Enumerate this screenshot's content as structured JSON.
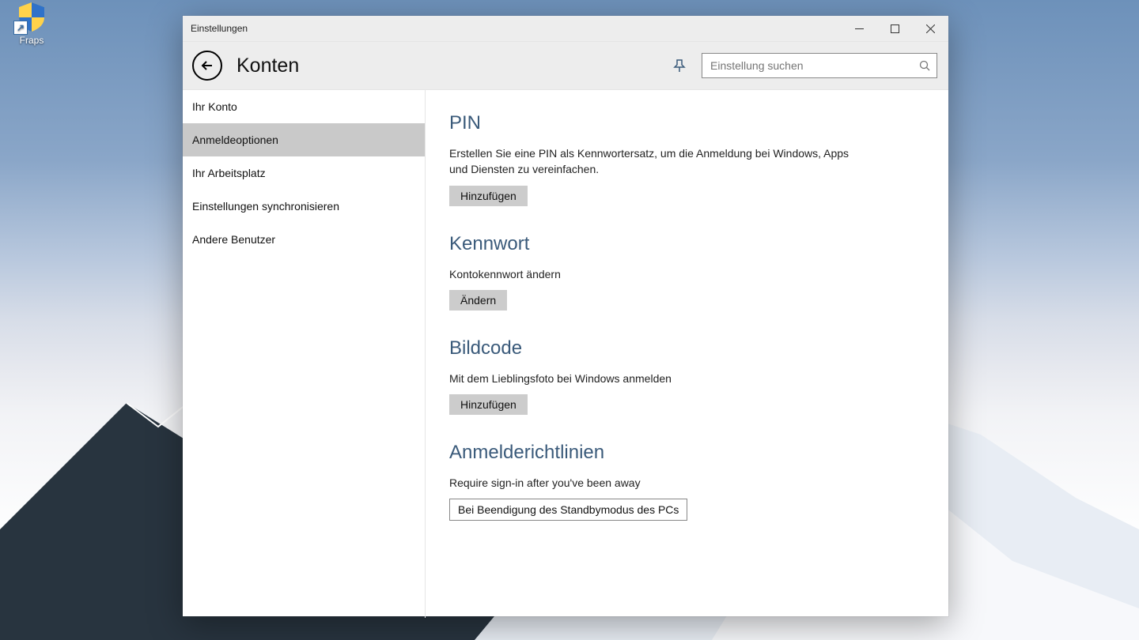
{
  "desktop": {
    "icon_label": "Fraps"
  },
  "window": {
    "title": "Einstellungen"
  },
  "header": {
    "page_title": "Konten",
    "search_placeholder": "Einstellung suchen"
  },
  "sidebar": {
    "items": [
      {
        "label": "Ihr Konto"
      },
      {
        "label": "Anmeldeoptionen"
      },
      {
        "label": "Ihr Arbeitsplatz"
      },
      {
        "label": "Einstellungen synchronisieren"
      },
      {
        "label": "Andere Benutzer"
      }
    ],
    "selected_index": 1
  },
  "content": {
    "pin": {
      "heading": "PIN",
      "text": "Erstellen Sie eine PIN als Kennwortersatz, um die Anmeldung bei Windows, Apps und Diensten zu vereinfachen.",
      "button": "Hinzufügen"
    },
    "password": {
      "heading": "Kennwort",
      "text": "Kontokennwort ändern",
      "button": "Ändern"
    },
    "picture": {
      "heading": "Bildcode",
      "text": "Mit dem Lieblingsfoto bei Windows anmelden",
      "button": "Hinzufügen"
    },
    "policy": {
      "heading": "Anmelderichtlinien",
      "text": "Require sign-in after you've been away",
      "select_value": "Bei Beendigung des Standbymodus des PCs"
    }
  }
}
